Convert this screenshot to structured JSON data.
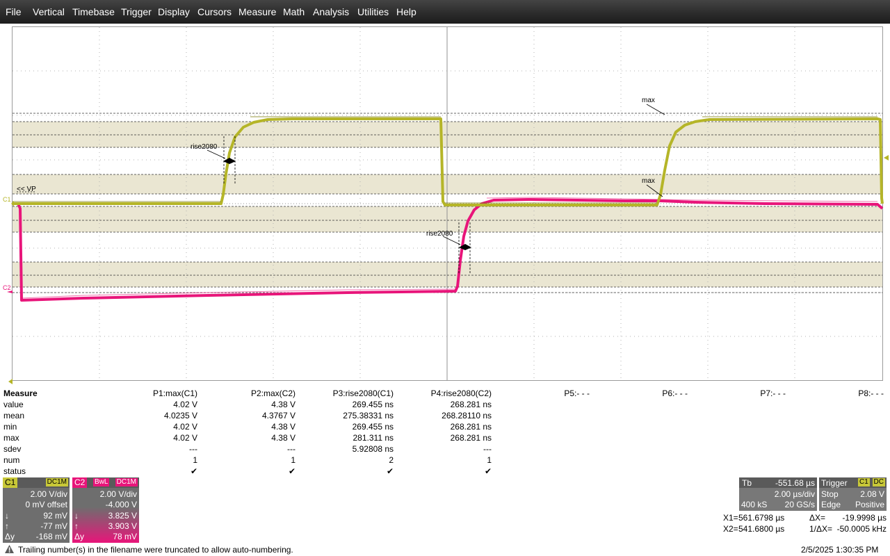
{
  "menu": [
    "File",
    "Vertical",
    "Timebase",
    "Trigger",
    "Display",
    "Cursors",
    "Measure",
    "Math",
    "Analysis",
    "Utilities",
    "Help"
  ],
  "colors": {
    "c1": "#b5b528",
    "c1_dark": "#8c8c14",
    "c2": "#e8157a",
    "band": "#eae6d2"
  },
  "grid_labels": {
    "c1_marker": "C1",
    "c2_marker": "C2",
    "vp": "<< VP",
    "c1_max": "max",
    "c2_max": "max",
    "c1_rise": "rise2080",
    "c2_rise": "rise2080"
  },
  "measure": {
    "title": "Measure",
    "row_labels": [
      "value",
      "mean",
      "min",
      "max",
      "sdev",
      "num",
      "status"
    ],
    "params": [
      {
        "name": "P1:max(C1)",
        "values": [
          "4.02 V",
          "4.0235 V",
          "4.02 V",
          "4.02 V",
          "---",
          "1",
          "✔"
        ]
      },
      {
        "name": "P2:max(C2)",
        "values": [
          "4.38 V",
          "4.3767 V",
          "4.38 V",
          "4.38 V",
          "---",
          "1",
          "✔"
        ]
      },
      {
        "name": "P3:rise2080(C1)",
        "values": [
          "269.455 ns",
          "275.38331 ns",
          "269.455 ns",
          "281.311 ns",
          "5.92808 ns",
          "2",
          "✔"
        ]
      },
      {
        "name": "P4:rise2080(C2)",
        "values": [
          "268.281 ns",
          "268.28110 ns",
          "268.281 ns",
          "268.281 ns",
          "---",
          "1",
          "✔"
        ]
      },
      {
        "name": "P5:- - -",
        "values": []
      },
      {
        "name": "P6:- - -",
        "values": []
      },
      {
        "name": "P7:- - -",
        "values": []
      },
      {
        "name": "P8:- - -",
        "values": []
      }
    ]
  },
  "channels": {
    "c1": {
      "label": "C1",
      "coupling": "DC1M",
      "scale": "2.00 V/div",
      "offset": "0 mV offset",
      "down_sym": "↓",
      "down": "92 mV",
      "up_sym": "↑",
      "up": "-77 mV",
      "dy_sym": "Δy",
      "dy": "-168 mV"
    },
    "c2": {
      "label": "C2",
      "bw": "BwL",
      "coupling": "DC1M",
      "scale": "2.00 V/div",
      "offset": "-4.000 V",
      "down_sym": "↓",
      "down": "3.825 V",
      "up_sym": "↑",
      "up": "3.903 V",
      "dy_sym": "Δy",
      "dy": "78 mV"
    }
  },
  "timebase": {
    "label": "Tb",
    "delay": "-551.68 µs",
    "scale": "2.00 µs/div",
    "samples": "400 kS",
    "rate": "20 GS/s"
  },
  "trigger": {
    "label": "Trigger",
    "source": "C1",
    "coupling": "DC",
    "mode": "Stop",
    "level": "2.08 V",
    "type": "Edge",
    "slope": "Positive"
  },
  "cursors": {
    "x1_label": "X1=",
    "x1": "561.6798 µs",
    "x2_label": "X2=",
    "x2": "541.6800 µs",
    "dx_label": "ΔX=",
    "dx": "-19.9998 µs",
    "inv_dx_label": "1/ΔX=",
    "inv_dx": "-50.0005 kHz"
  },
  "status": {
    "icon": "warning-icon",
    "message": "Trailing number(s) in the filename were truncated to allow auto-numbering.",
    "datetime": "2/5/2025 1:30:35 PM"
  }
}
